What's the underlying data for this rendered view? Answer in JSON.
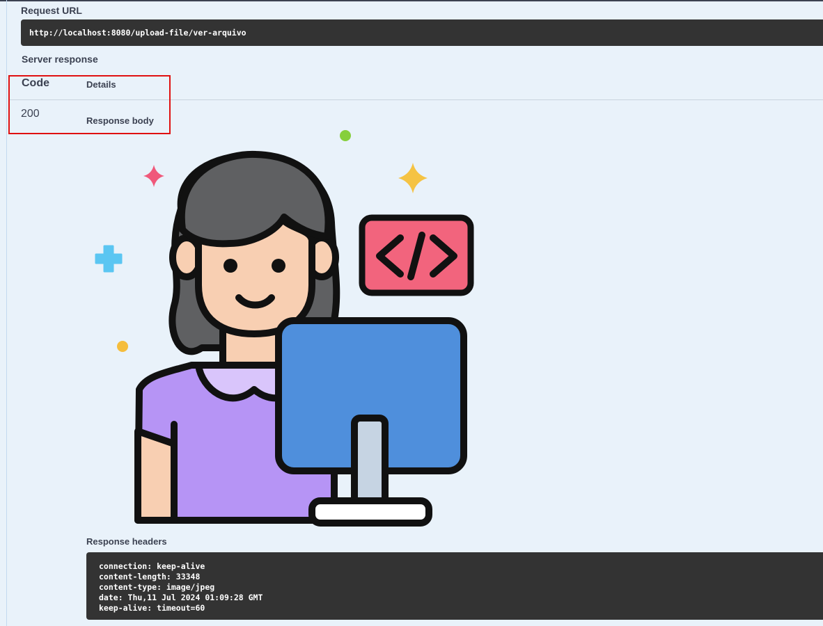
{
  "request_url": {
    "label": "Request URL",
    "value": "http://localhost:8080/upload-file/ver-arquivo"
  },
  "server_response": {
    "label": "Server response",
    "columns": {
      "code": "Code",
      "details": "Details"
    },
    "row": {
      "code": "200",
      "body_label": "Response body"
    }
  },
  "response_headers": {
    "label": "Response headers",
    "lines": [
      "connection: keep-alive",
      "content-length: 33348",
      "content-type: image/jpeg",
      "date: Thu,11 Jul 2024 01:09:28 GMT",
      "keep-alive: timeout=60"
    ]
  },
  "colors": {
    "page_bg": "#e9f2fa",
    "code_bg": "#333333",
    "highlight": "#e01010"
  }
}
